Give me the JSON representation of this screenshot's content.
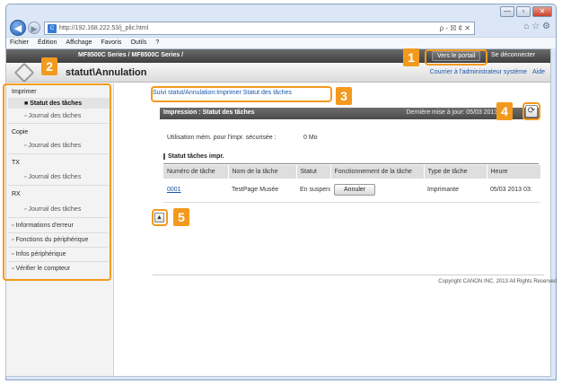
{
  "browser": {
    "url": "http://192.168.222.53/j_plic.html",
    "url_tools": "ρ - ☒ ¢ ✕",
    "right_icons": "⌂ ☆ ⚙",
    "window_buttons": [
      "—",
      "▫",
      "✕"
    ],
    "menu": [
      "Fichier",
      "Édition",
      "Affichage",
      "Favoris",
      "Outils",
      "?"
    ]
  },
  "header": {
    "device_name": "MF8500C Series / MF8500C Series /",
    "portal_button": "Vers le portail",
    "logout": "Se déconnecter",
    "page_title": "statut\\Annulation",
    "links": [
      "Courrier à l'administrateur système",
      "Aide"
    ]
  },
  "sidebar": {
    "categories": [
      {
        "label": "Imprimer",
        "items": [
          "Statut des tâches",
          "Journal des tâches"
        ]
      },
      {
        "label": "Copie",
        "items": [
          "Journal des tâches"
        ]
      },
      {
        "label": "TX",
        "items": [
          "Journal des tâches"
        ]
      },
      {
        "label": "RX",
        "items": [
          "Journal des tâches"
        ]
      }
    ],
    "links": [
      "Informations d'erreur",
      "Fonctions du périphérique",
      "Infos périphérique",
      "Vérifier le compteur"
    ]
  },
  "main": {
    "breadcrumb": "Suivi statut/Annulation:Imprimer Statut des tâches",
    "section_title": "Impression : Statut des tâches",
    "last_update": "Dernière mise à jour: 05/03 2013 03:",
    "memory_label": "Utilisation mém. pour l'impr. sécurisée :",
    "memory_value": "0 Mo",
    "status_title": "Statut tâches impr.",
    "table": {
      "headers": [
        "Numéro de tâche",
        "Nom de la tâche",
        "Statut",
        "Fonctionnement de la tâche",
        "Type de tâche",
        "Heure"
      ],
      "rows": [
        {
          "job_no": "0001",
          "name": "TestPage Musée",
          "status": "En suspens",
          "action": "Annuler",
          "type": "Imprimante",
          "time": "05/03 2013 03:"
        }
      ]
    },
    "copyright": "Copyright CANON INC. 2013 All Rights Reserved"
  },
  "callouts": [
    "1",
    "2",
    "3",
    "4",
    "5"
  ],
  "colors": {
    "callout": "#f39a1e",
    "link": "#1a56a8",
    "topbar": "#4a4a4a"
  },
  "icons": {
    "logo": "canon-diamond-icon",
    "refresh": "refresh-icon",
    "page_top": "page-top-icon"
  }
}
